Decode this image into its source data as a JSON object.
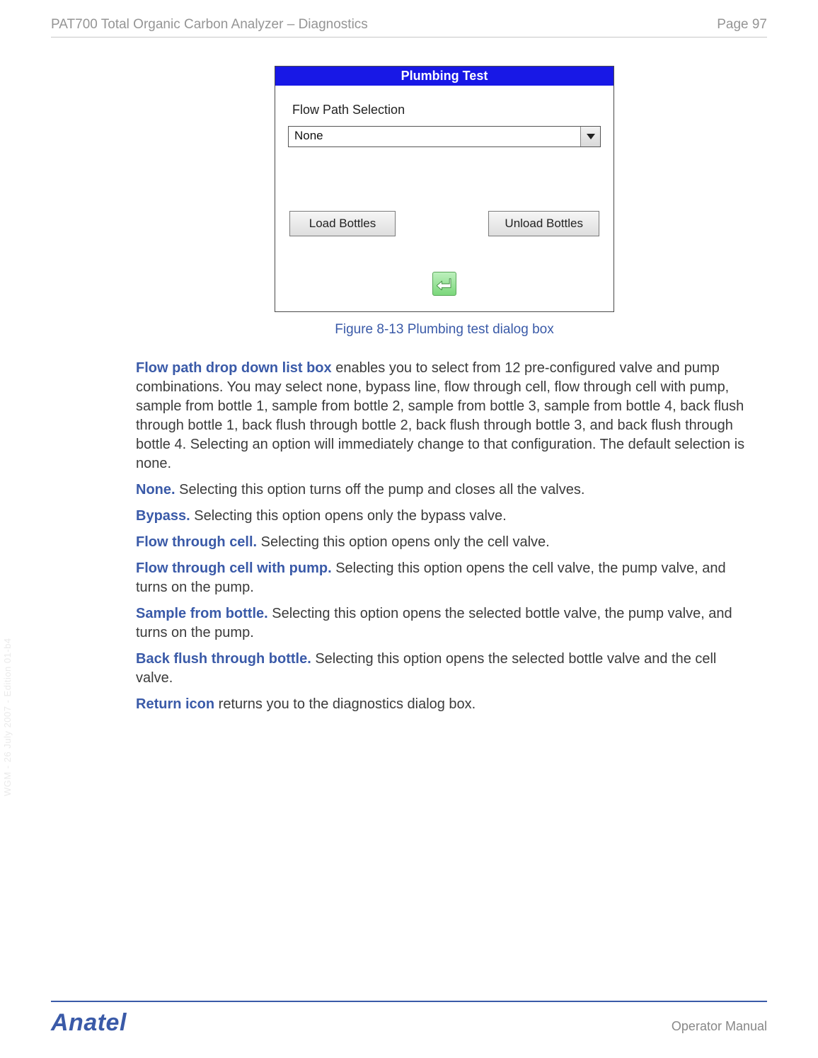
{
  "header": {
    "title": "PAT700 Total Organic Carbon Analyzer – Diagnostics",
    "page_label": "Page 97"
  },
  "dialog": {
    "title": "Plumbing Test",
    "field_label": "Flow Path Selection",
    "combo_value": "None",
    "load_button": "Load Bottles",
    "unload_button": "Unload Bottles"
  },
  "figure_caption": "Figure 8-13 Plumbing test dialog box",
  "paragraphs": [
    {
      "bold": "Flow path drop down list box",
      "rest": " enables you to select from 12 pre-configured valve and pump combinations. You may select none, bypass line, flow through cell, flow through cell with pump, sample from bottle 1, sample from bottle 2, sample from bottle 3, sample from bottle 4, back flush through bottle 1, back flush through bottle 2, back flush through bottle 3, and back flush through bottle 4. Selecting an option will immediately change to that configuration. The default selection is none."
    },
    {
      "bold": "None.",
      "rest": " Selecting this option turns off the pump and closes all the valves."
    },
    {
      "bold": "Bypass.",
      "rest": " Selecting this option opens only the bypass valve."
    },
    {
      "bold": "Flow through cell.",
      "rest": " Selecting this option opens only the cell valve."
    },
    {
      "bold": "Flow through cell with pump.",
      "rest": " Selecting this option opens the cell valve, the pump valve, and turns on the pump."
    },
    {
      "bold": "Sample from bottle.",
      "rest": " Selecting this option opens the selected bottle valve, the pump valve, and turns on the pump."
    },
    {
      "bold": "Back flush through bottle.",
      "rest": " Selecting this option opens the selected bottle valve and the cell valve."
    },
    {
      "bold": "Return icon",
      "rest": " returns you to the diagnostics dialog box."
    }
  ],
  "side_text": "WGM - 26 July 2007 - Edition 01-b4",
  "footer": {
    "brand": "Anatel",
    "right": "Operator Manual"
  }
}
